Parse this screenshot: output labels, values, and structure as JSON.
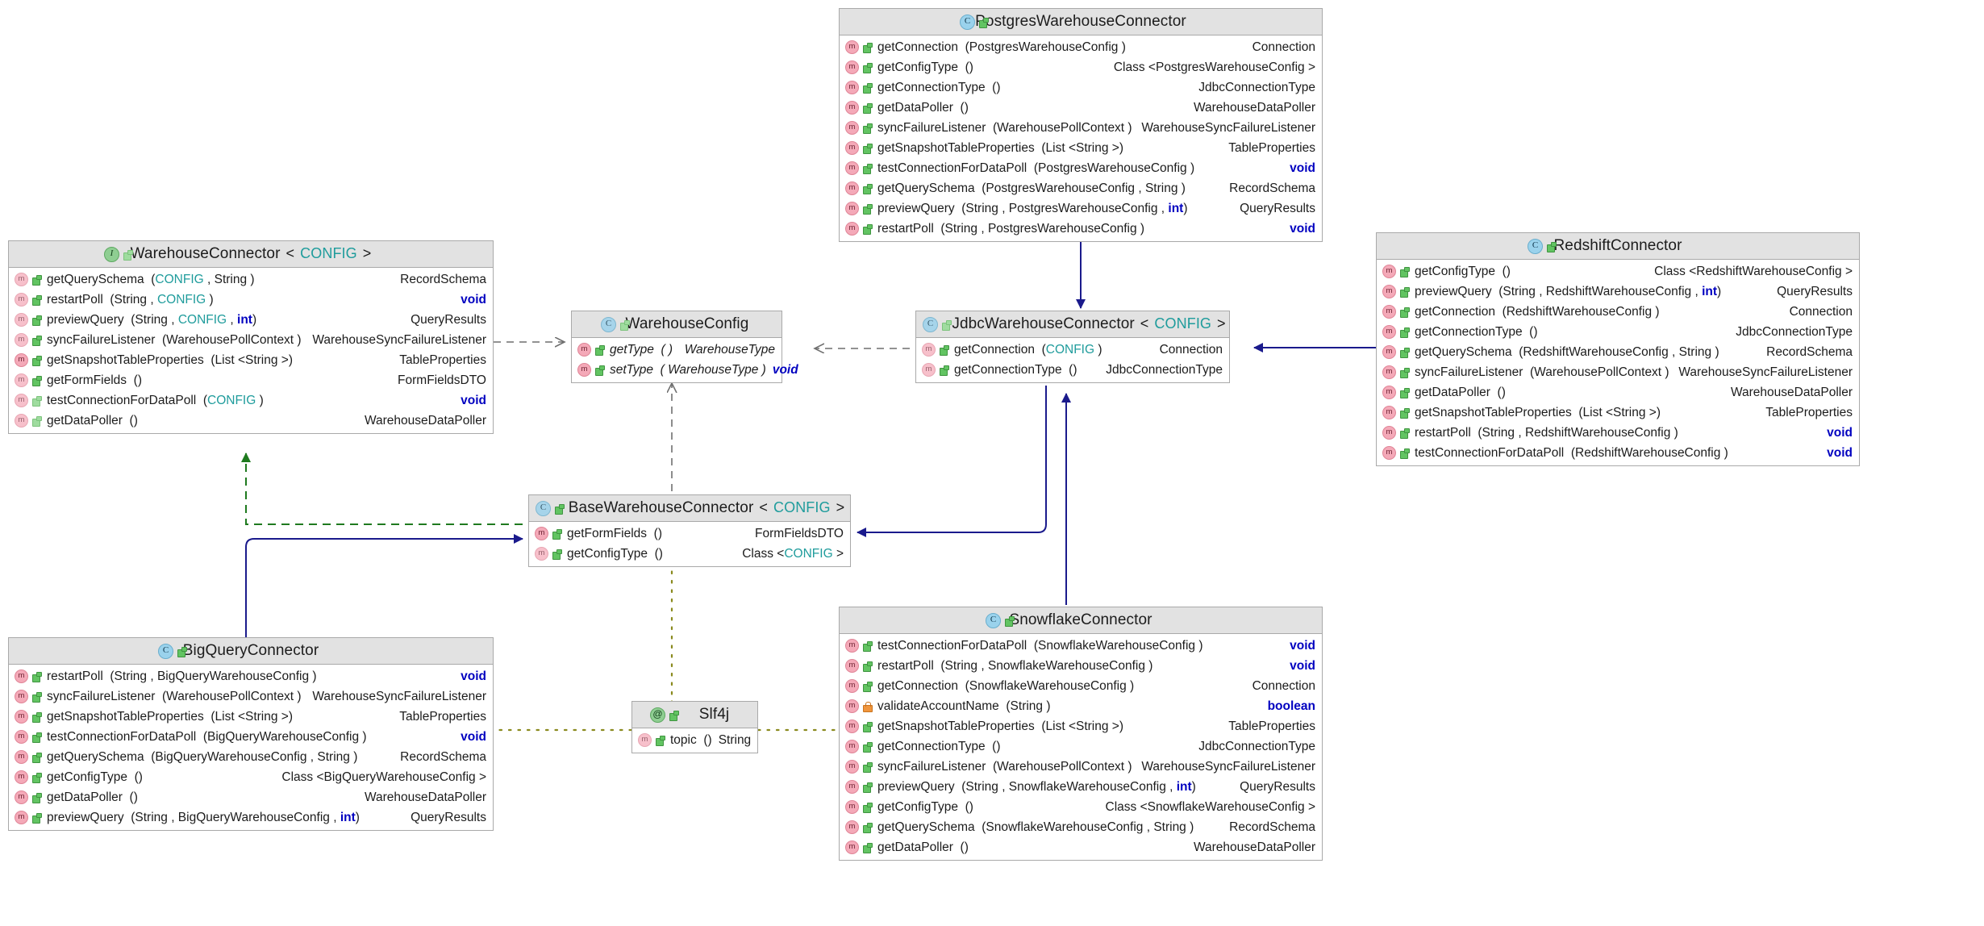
{
  "diagram": {
    "type": "uml-class-diagram",
    "colors": {
      "header_fill": "#e2e2e2",
      "box_border": "#a9a9a9",
      "generic_param": "#1f9c9c",
      "keyword": "#0000c0",
      "inherit_arrow": "#1a1a8c",
      "realize_arrow_green": "#1f7a1f",
      "dependency_arrow_gray": "#6f6f6f",
      "annotation_link": "#8a8a1e"
    }
  },
  "classes": {
    "postgres": {
      "name": "PostgresWarehouseConnector",
      "stereotype": "class",
      "generic": "",
      "members": [
        {
          "icon": "method",
          "vis": "public",
          "name": "getConnection",
          "params": "(PostgresWarehouseConfig   )",
          "ret": "Connection",
          "ret_kw": false
        },
        {
          "icon": "method",
          "vis": "public",
          "name": "getConfigType",
          "params": "()",
          "ret": "Class <PostgresWarehouseConfig   >",
          "ret_kw": false
        },
        {
          "icon": "method",
          "vis": "public",
          "name": "getConnectionType",
          "params": "()",
          "ret": "JdbcConnectionType",
          "ret_kw": false
        },
        {
          "icon": "method",
          "vis": "public",
          "name": "getDataPoller",
          "params": "()",
          "ret": "WarehouseDataPoller",
          "ret_kw": false
        },
        {
          "icon": "method",
          "vis": "public",
          "name": "syncFailureListener",
          "params": "(WarehousePollContext   )",
          "ret": "WarehouseSyncFailureListener",
          "ret_kw": false
        },
        {
          "icon": "method",
          "vis": "public",
          "name": "getSnapshotTableProperties",
          "params": "(List <String >)",
          "ret": "TableProperties",
          "ret_kw": false
        },
        {
          "icon": "method",
          "vis": "public",
          "name": "testConnectionForDataPoll",
          "params": "(PostgresWarehouseConfig   )",
          "ret": "void",
          "ret_kw": true
        },
        {
          "icon": "method",
          "vis": "public",
          "name": "getQuerySchema",
          "params": "(PostgresWarehouseConfig   , String )",
          "ret": "RecordSchema",
          "ret_kw": false
        },
        {
          "icon": "method",
          "vis": "public",
          "name": "previewQuery",
          "params": "(String , PostgresWarehouseConfig   , int)",
          "ret": "QueryResults",
          "ret_kw": false
        },
        {
          "icon": "method",
          "vis": "public",
          "name": "restartPoll",
          "params": "(String , PostgresWarehouseConfig   )",
          "ret": "void",
          "ret_kw": true
        }
      ]
    },
    "warehouse_connector": {
      "name": "WarehouseConnector",
      "stereotype": "interface",
      "generic": "CONFIG",
      "members": [
        {
          "icon": "method-faded",
          "vis": "public",
          "name": "getQuerySchema",
          "params": "(CONFIG , String )",
          "ret": "RecordSchema",
          "ret_kw": false
        },
        {
          "icon": "method-faded",
          "vis": "public",
          "name": "restartPoll",
          "params": "(String , CONFIG )",
          "ret": "void",
          "ret_kw": true
        },
        {
          "icon": "method-faded",
          "vis": "public",
          "name": "previewQuery",
          "params": "(String , CONFIG , int)",
          "ret": "QueryResults",
          "ret_kw": false
        },
        {
          "icon": "method-faded",
          "vis": "public",
          "name": "syncFailureListener",
          "params": "(WarehousePollContext   )",
          "ret": "WarehouseSyncFailureListener",
          "ret_kw": false
        },
        {
          "icon": "method",
          "vis": "public",
          "name": "getSnapshotTableProperties",
          "params": "(List <String >)",
          "ret": "TableProperties",
          "ret_kw": false
        },
        {
          "icon": "method-faded",
          "vis": "public",
          "name": "getFormFields",
          "params": "()",
          "ret": "FormFieldsDTO",
          "ret_kw": false
        },
        {
          "icon": "method-faded",
          "vis": "public-pale",
          "name": "testConnectionForDataPoll",
          "params": "(CONFIG )",
          "ret": "void",
          "ret_kw": true
        },
        {
          "icon": "method-faded",
          "vis": "public-pale",
          "name": "getDataPoller",
          "params": "()",
          "ret": "WarehouseDataPoller",
          "ret_kw": false
        }
      ]
    },
    "warehouse_config": {
      "name": "WarehouseConfig",
      "stereotype": "class-abstract",
      "generic": "",
      "members": [
        {
          "icon": "method",
          "vis": "public",
          "name": "getType",
          "params": "( )",
          "ret": "WarehouseType",
          "ret_kw": false,
          "italic": true
        },
        {
          "icon": "method",
          "vis": "public",
          "name": "setType",
          "params": "( WarehouseType   )",
          "ret": "void",
          "ret_kw": true,
          "italic": true
        }
      ]
    },
    "jdbc": {
      "name": "JdbcWarehouseConnector",
      "stereotype": "class-abstract",
      "generic": "CONFIG",
      "members": [
        {
          "icon": "method-faded",
          "vis": "public",
          "name": "getConnection",
          "params": "(CONFIG )",
          "ret": "Connection",
          "ret_kw": false
        },
        {
          "icon": "method-faded",
          "vis": "public",
          "name": "getConnectionType",
          "params": "()",
          "ret": "JdbcConnectionType",
          "ret_kw": false
        }
      ]
    },
    "redshift": {
      "name": "RedshiftConnector",
      "stereotype": "class",
      "generic": "",
      "members": [
        {
          "icon": "method",
          "vis": "public",
          "name": "getConfigType",
          "params": "()",
          "ret": "Class <RedshiftWarehouseConfig   >",
          "ret_kw": false
        },
        {
          "icon": "method",
          "vis": "public",
          "name": "previewQuery",
          "params": "(String , RedshiftWarehouseConfig   , int)",
          "ret": "QueryResults",
          "ret_kw": false
        },
        {
          "icon": "method",
          "vis": "public",
          "name": "getConnection",
          "params": "(RedshiftWarehouseConfig   )",
          "ret": "Connection",
          "ret_kw": false
        },
        {
          "icon": "method",
          "vis": "public",
          "name": "getConnectionType",
          "params": "()",
          "ret": "JdbcConnectionType",
          "ret_kw": false
        },
        {
          "icon": "method",
          "vis": "public",
          "name": "getQuerySchema",
          "params": "(RedshiftWarehouseConfig   , String )",
          "ret": "RecordSchema",
          "ret_kw": false
        },
        {
          "icon": "method",
          "vis": "public",
          "name": "syncFailureListener",
          "params": "(WarehousePollContext   )",
          "ret": "WarehouseSyncFailureListener",
          "ret_kw": false
        },
        {
          "icon": "method",
          "vis": "public",
          "name": "getDataPoller",
          "params": "()",
          "ret": "WarehouseDataPoller",
          "ret_kw": false
        },
        {
          "icon": "method",
          "vis": "public",
          "name": "getSnapshotTableProperties",
          "params": "(List <String >)",
          "ret": "TableProperties",
          "ret_kw": false
        },
        {
          "icon": "method",
          "vis": "public",
          "name": "restartPoll",
          "params": "(String , RedshiftWarehouseConfig   )",
          "ret": "void",
          "ret_kw": true
        },
        {
          "icon": "method",
          "vis": "public",
          "name": "testConnectionForDataPoll",
          "params": "(RedshiftWarehouseConfig   )",
          "ret": "void",
          "ret_kw": true
        }
      ]
    },
    "base": {
      "name": "BaseWarehouseConnector",
      "stereotype": "class-abstract",
      "generic": "CONFIG",
      "members": [
        {
          "icon": "method",
          "vis": "public",
          "name": "getFormFields",
          "params": "()",
          "ret": "FormFieldsDTO",
          "ret_kw": false
        },
        {
          "icon": "method-faded",
          "vis": "public",
          "name": "getConfigType",
          "params": "()",
          "ret": "Class <CONFIG >",
          "ret_kw": false
        }
      ]
    },
    "bigquery": {
      "name": "BigQueryConnector",
      "stereotype": "class",
      "generic": "",
      "members": [
        {
          "icon": "method",
          "vis": "public",
          "name": "restartPoll",
          "params": "(String , BigQueryWarehouseConfig   )",
          "ret": "void",
          "ret_kw": true
        },
        {
          "icon": "method",
          "vis": "public",
          "name": "syncFailureListener",
          "params": "(WarehousePollContext   )",
          "ret": "WarehouseSyncFailureListener",
          "ret_kw": false
        },
        {
          "icon": "method",
          "vis": "public",
          "name": "getSnapshotTableProperties",
          "params": "(List <String >)",
          "ret": "TableProperties",
          "ret_kw": false
        },
        {
          "icon": "method",
          "vis": "public",
          "name": "testConnectionForDataPoll",
          "params": "(BigQueryWarehouseConfig   )",
          "ret": "void",
          "ret_kw": true
        },
        {
          "icon": "method",
          "vis": "public",
          "name": "getQuerySchema",
          "params": "(BigQueryWarehouseConfig   , String )",
          "ret": "RecordSchema",
          "ret_kw": false
        },
        {
          "icon": "method",
          "vis": "public",
          "name": "getConfigType",
          "params": "()",
          "ret": "Class <BigQueryWarehouseConfig   >",
          "ret_kw": false
        },
        {
          "icon": "method",
          "vis": "public",
          "name": "getDataPoller",
          "params": "()",
          "ret": "WarehouseDataPoller",
          "ret_kw": false
        },
        {
          "icon": "method",
          "vis": "public",
          "name": "previewQuery",
          "params": "(String , BigQueryWarehouseConfig   , int)",
          "ret": "QueryResults",
          "ret_kw": false
        }
      ]
    },
    "slf4j": {
      "name": "Slf4j",
      "stereotype": "annotation",
      "generic": "",
      "members": [
        {
          "icon": "method-faded",
          "vis": "public",
          "name": "topic",
          "params": "()",
          "ret": "String",
          "ret_kw": false,
          "inline": true
        }
      ]
    },
    "snowflake": {
      "name": "SnowflakeConnector",
      "stereotype": "class",
      "generic": "",
      "members": [
        {
          "icon": "method",
          "vis": "public",
          "name": "testConnectionForDataPoll",
          "params": "(SnowflakeWarehouseConfig   )",
          "ret": "void",
          "ret_kw": true
        },
        {
          "icon": "method",
          "vis": "public",
          "name": "restartPoll",
          "params": "(String , SnowflakeWarehouseConfig   )",
          "ret": "void",
          "ret_kw": true
        },
        {
          "icon": "method",
          "vis": "public",
          "name": "getConnection",
          "params": "(SnowflakeWarehouseConfig   )",
          "ret": "Connection",
          "ret_kw": false
        },
        {
          "icon": "method",
          "vis": "private",
          "name": "validateAccountName",
          "params": "(String )",
          "ret": "boolean",
          "ret_kw": true
        },
        {
          "icon": "method",
          "vis": "public",
          "name": "getSnapshotTableProperties",
          "params": "(List <String >)",
          "ret": "TableProperties",
          "ret_kw": false
        },
        {
          "icon": "method",
          "vis": "public",
          "name": "getConnectionType",
          "params": "()",
          "ret": "JdbcConnectionType",
          "ret_kw": false
        },
        {
          "icon": "method",
          "vis": "public",
          "name": "syncFailureListener",
          "params": "(WarehousePollContext   )",
          "ret": "WarehouseSyncFailureListener",
          "ret_kw": false
        },
        {
          "icon": "method",
          "vis": "public",
          "name": "previewQuery",
          "params": "(String , SnowflakeWarehouseConfig   , int)",
          "ret": "QueryResults",
          "ret_kw": false
        },
        {
          "icon": "method",
          "vis": "public",
          "name": "getConfigType",
          "params": "()",
          "ret": "Class <SnowflakeWarehouseConfig   >",
          "ret_kw": false
        },
        {
          "icon": "method",
          "vis": "public",
          "name": "getQuerySchema",
          "params": "(SnowflakeWarehouseConfig   , String )",
          "ret": "RecordSchema",
          "ret_kw": false
        },
        {
          "icon": "method",
          "vis": "public",
          "name": "getDataPoller",
          "params": "()",
          "ret": "WarehouseDataPoller",
          "ret_kw": false
        }
      ]
    }
  },
  "relationships": [
    {
      "from": "PostgresWarehouseConnector",
      "to": "JdbcWarehouseConnector",
      "kind": "generalization",
      "style": "solid",
      "color": "#1a1a8c"
    },
    {
      "from": "RedshiftConnector",
      "to": "JdbcWarehouseConnector",
      "kind": "generalization",
      "style": "solid",
      "color": "#1a1a8c"
    },
    {
      "from": "SnowflakeConnector",
      "to": "JdbcWarehouseConnector",
      "kind": "generalization",
      "style": "solid",
      "color": "#1a1a8c"
    },
    {
      "from": "JdbcWarehouseConnector",
      "to": "BaseWarehouseConnector",
      "kind": "generalization",
      "style": "solid",
      "color": "#1a1a8c"
    },
    {
      "from": "BigQueryConnector",
      "to": "BaseWarehouseConnector",
      "kind": "generalization",
      "style": "solid",
      "color": "#1a1a8c"
    },
    {
      "from": "BaseWarehouseConnector",
      "to": "WarehouseConnector",
      "kind": "realization",
      "style": "dashed",
      "color": "#1f7a1f"
    },
    {
      "from": "BaseWarehouseConnector",
      "to": "WarehouseConfig",
      "kind": "dependency",
      "style": "dashed",
      "color": "#6f6f6f"
    },
    {
      "from": "JdbcWarehouseConnector",
      "to": "WarehouseConfig",
      "kind": "dependency",
      "style": "dashed",
      "color": "#6f6f6f"
    },
    {
      "from": "WarehouseConnector",
      "to": "WarehouseConfig",
      "kind": "dependency",
      "style": "dashed",
      "color": "#6f6f6f"
    },
    {
      "from": "Slf4j",
      "to": "BaseWarehouseConnector",
      "kind": "annotation",
      "style": "dotted",
      "color": "#8a8a1e"
    },
    {
      "from": "Slf4j",
      "to": "BigQueryConnector",
      "kind": "annotation",
      "style": "dotted",
      "color": "#8a8a1e"
    },
    {
      "from": "Slf4j",
      "to": "SnowflakeConnector",
      "kind": "annotation",
      "style": "dotted",
      "color": "#8a8a1e"
    }
  ]
}
